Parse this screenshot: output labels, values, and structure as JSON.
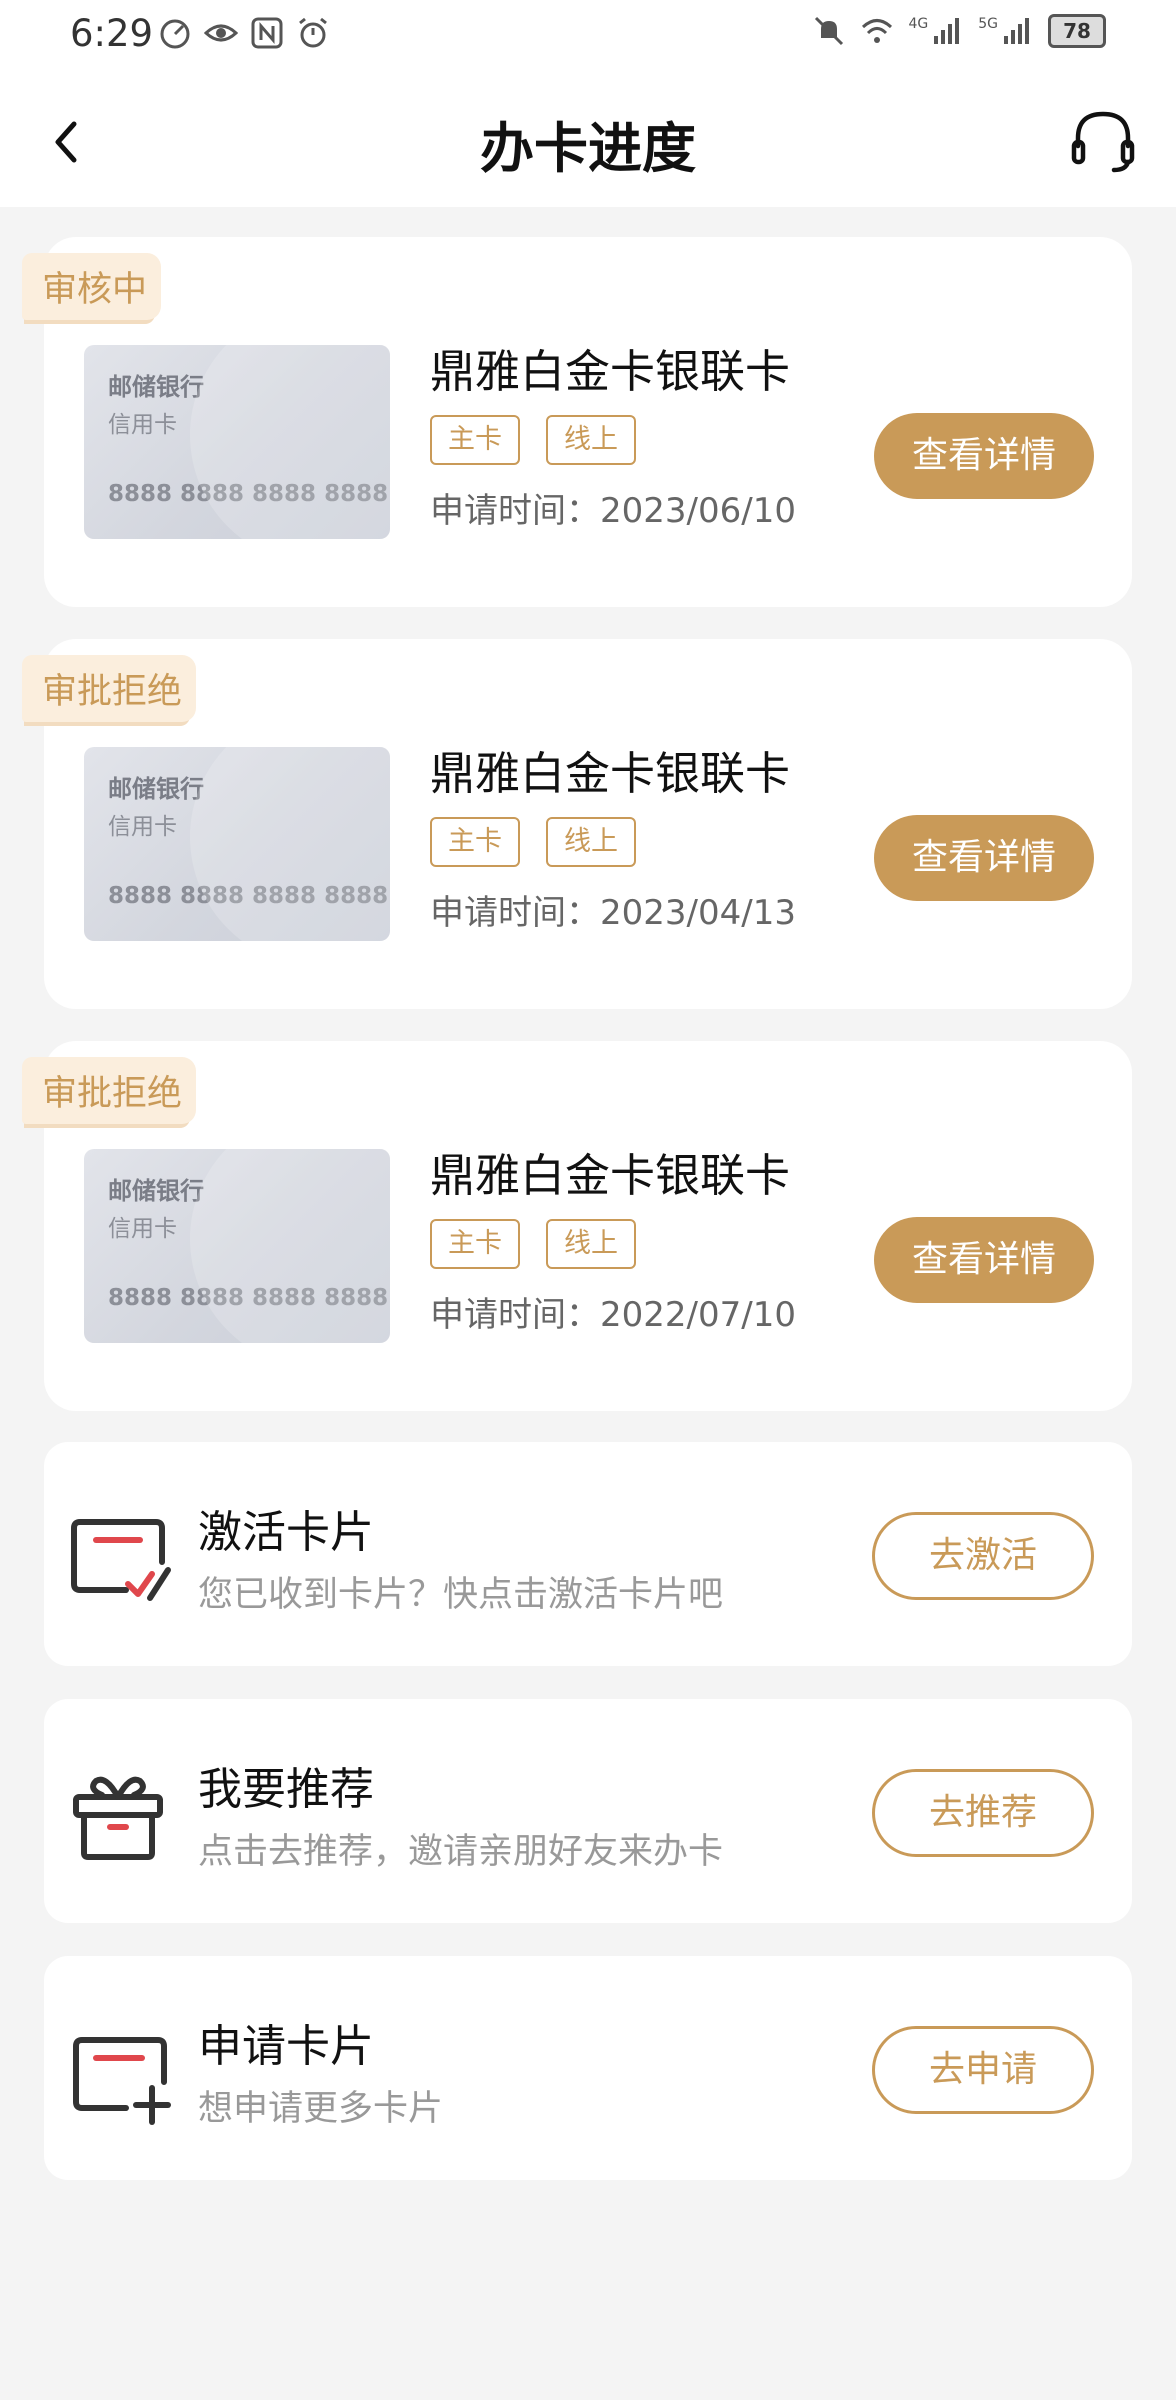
{
  "status_bar": {
    "time": "6:29",
    "battery": "78",
    "network_1": "4G",
    "network_2": "5G"
  },
  "nav": {
    "title": "办卡进度",
    "back_icon": "chevron-left-icon",
    "support_icon": "headset-icon"
  },
  "applications": [
    {
      "status": "审核中",
      "card_bank": "邮储银行",
      "card_type": "信用卡",
      "card_number": "8888 8888 8888 8888",
      "name": "鼎雅白金卡银联卡",
      "tags": [
        "主卡",
        "线上"
      ],
      "apply_time": "申请时间：2023/06/10",
      "button": "查看详情"
    },
    {
      "status": "审批拒绝",
      "card_bank": "邮储银行",
      "card_type": "信用卡",
      "card_number": "8888 8888 8888 8888",
      "name": "鼎雅白金卡银联卡",
      "tags": [
        "主卡",
        "线上"
      ],
      "apply_time": "申请时间：2023/04/13",
      "button": "查看详情"
    },
    {
      "status": "审批拒绝",
      "card_bank": "邮储银行",
      "card_type": "信用卡",
      "card_number": "8888 8888 8888 8888",
      "name": "鼎雅白金卡银联卡",
      "tags": [
        "主卡",
        "线上"
      ],
      "apply_time": "申请时间：2022/07/10",
      "button": "查看详情"
    }
  ],
  "actions": [
    {
      "icon": "card-activate-icon",
      "title": "激活卡片",
      "subtitle": "您已收到卡片？快点击激活卡片吧",
      "button": "去激活"
    },
    {
      "icon": "gift-icon",
      "title": "我要推荐",
      "subtitle": "点击去推荐，邀请亲朋好友来办卡",
      "button": "去推荐"
    },
    {
      "icon": "card-add-icon",
      "title": "申请卡片",
      "subtitle": "想申请更多卡片",
      "button": "去申请"
    }
  ],
  "colors": {
    "accent": "#c99a58",
    "tag_bg": "#fbeedd",
    "icon_red": "#e0474c",
    "background": "#f4f4f4"
  }
}
